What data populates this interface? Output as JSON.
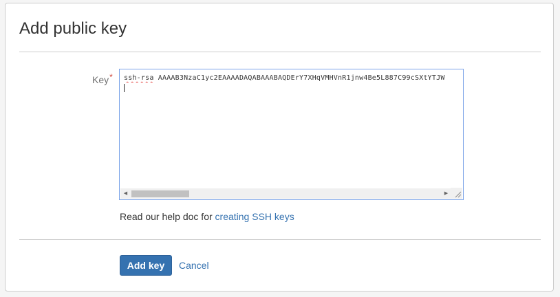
{
  "dialog": {
    "title": "Add public key"
  },
  "form": {
    "key_label": "Key",
    "required_marker": "*",
    "key_value_prefix": "ssh-rsa",
    "key_value_rest": " AAAAB3NzaC1yc2EAAAADAQABAAABAQDErY7XHqVMHVnR1jnw4Be5L887C99cSXtYTJW"
  },
  "help": {
    "text": "Read our help doc for ",
    "link_label": "creating SSH keys"
  },
  "actions": {
    "add_label": "Add key",
    "cancel_label": "Cancel"
  },
  "colors": {
    "primary": "#3572b0",
    "required": "#d04437",
    "focus_border": "#7aa3e8"
  },
  "icons": {
    "scroll_left": "scroll-left-arrow-icon",
    "scroll_right": "scroll-right-arrow-icon",
    "resize": "resize-grip-icon"
  }
}
